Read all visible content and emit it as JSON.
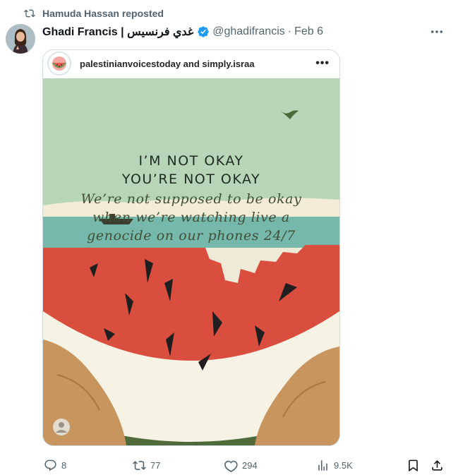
{
  "social_context": {
    "text": "Hamuda Hassan reposted"
  },
  "author": {
    "name": "Ghadi Francis | غدي فرنسيس",
    "handle": "@ghadifrancis",
    "separator": "·",
    "date": "Feb 6"
  },
  "embed": {
    "accounts": "palestinianvoicestoday and simply.israa",
    "menu": "•••",
    "poster": {
      "line1": "I’M NOT OKAY",
      "line2": "YOU’RE NOT OKAY",
      "line3": "We’re not supposed to be okay",
      "line4": "when we’re watching live a",
      "line5": "genocide on our phones 24/7"
    }
  },
  "actions": {
    "replies": "8",
    "reposts": "77",
    "likes": "294",
    "views": "9.5K"
  },
  "colors": {
    "sky": "#b7d6b8",
    "sand": "#f4ecd7",
    "sea": "#76b8ab",
    "melon": "#d94e3f",
    "rind": "#f6f2e4",
    "rind_dark": "#4e6a3a",
    "hands": "#c9955f",
    "verified": "#1d9bf0",
    "muted": "#536471"
  }
}
